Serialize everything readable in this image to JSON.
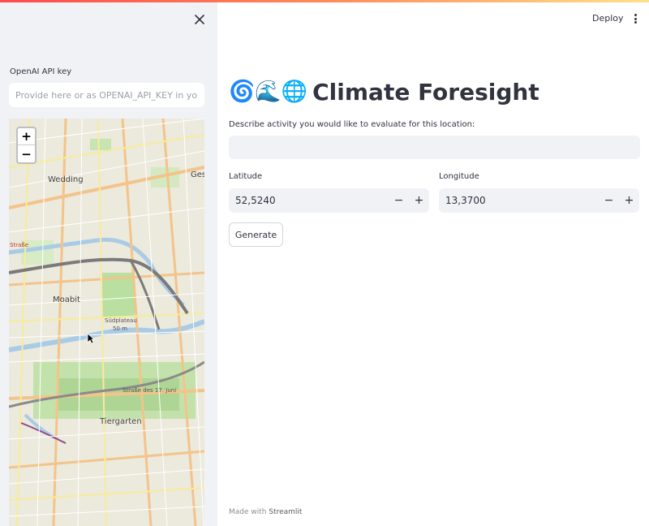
{
  "sidebar": {
    "api_key_label": "OpenAI API key",
    "api_key_placeholder": "Provide here or as OPENAI_API_KEY in your e",
    "map": {
      "zoom_in": "+",
      "zoom_out": "−",
      "labels": {
        "wedding": "Wedding",
        "moabit": "Moabit",
        "tiergarten": "Tiergarten",
        "ges": "Ges",
        "sudplateau": "Südplateau",
        "sudplateau_height": "50 m",
        "strasse17": "Straße des 17. Juni",
        "strasse": "Straße"
      }
    }
  },
  "header": {
    "deploy": "Deploy"
  },
  "main": {
    "title_emoji": "🌀🌊🌐",
    "title": "Climate Foresight",
    "activity_label": "Describe activity you would like to evaluate for this location:",
    "activity_value": "",
    "latitude_label": "Latitude",
    "latitude_value": "52,5240",
    "longitude_label": "Longitude",
    "longitude_value": "13,3700",
    "minus": "−",
    "plus": "+",
    "generate": "Generate"
  },
  "footer": {
    "made_with": "Made with",
    "brand": "Streamlit"
  }
}
